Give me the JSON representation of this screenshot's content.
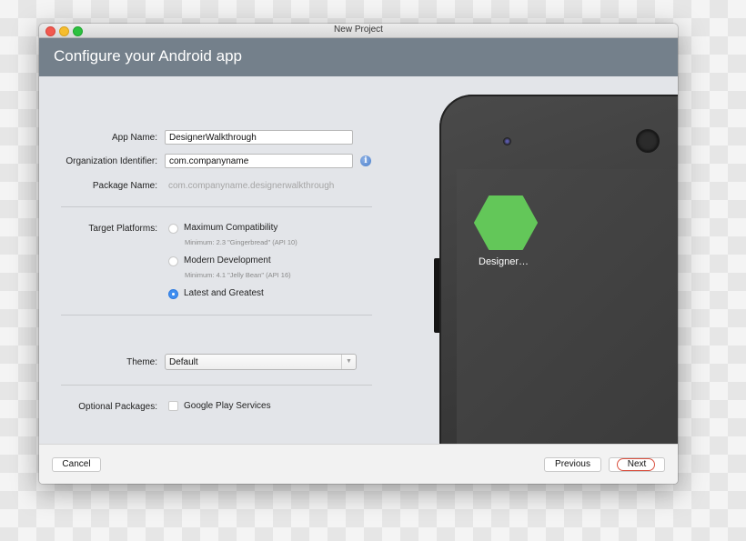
{
  "window": {
    "title": "New Project",
    "header_title": "Configure your Android app"
  },
  "form": {
    "app_name": {
      "label": "App Name:",
      "value": "DesignerWalkthrough"
    },
    "org_id": {
      "label": "Organization Identifier:",
      "value": "com.companyname",
      "info_icon": "info-icon"
    },
    "package_name": {
      "label": "Package Name:",
      "value": "com.companyname.designerwalkthrough"
    },
    "target_platforms": {
      "label": "Target Platforms:",
      "options": [
        {
          "label": "Maximum Compatibility",
          "sub": "Minimum: 2.3 \"Gingerbread\" (API 10)",
          "checked": false
        },
        {
          "label": "Modern Development",
          "sub": "Minimum: 4.1 \"Jelly Bean\" (API 16)",
          "checked": false
        },
        {
          "label": "Latest and Greatest",
          "sub": "",
          "checked": true
        }
      ]
    },
    "theme": {
      "label": "Theme:",
      "value": "Default"
    },
    "optional_packages": {
      "label": "Optional Packages:",
      "option": "Google Play Services",
      "checked": false
    }
  },
  "preview": {
    "app_label": "Designer…",
    "icon_color": "#63c759"
  },
  "footer": {
    "cancel": "Cancel",
    "previous": "Previous",
    "next": "Next"
  },
  "colors": {
    "header_bg": "#74808b",
    "radio_accent": "#3f8ef0",
    "next_highlight": "#d9503f"
  }
}
